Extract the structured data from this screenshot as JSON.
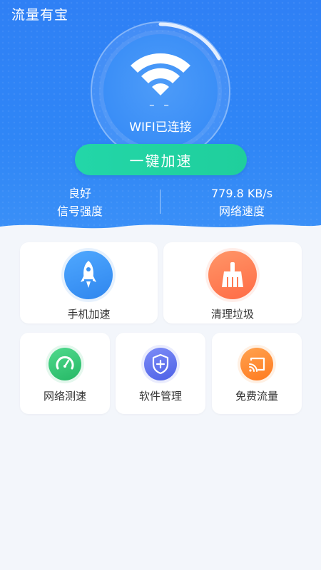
{
  "header": {
    "app_title": "流量有宝"
  },
  "status": {
    "speed_placeholder": "– –",
    "wifi_text": "WIFI已连接",
    "boost_label": "一键加速"
  },
  "stats": {
    "signal_value": "良好",
    "signal_label": "信号强度",
    "speed_value": "779.8 KB/s",
    "speed_label": "网络速度"
  },
  "tools": {
    "phone_boost": {
      "label": "手机加速",
      "icon": "rocket-icon",
      "color": "#2f8cf2"
    },
    "clean_junk": {
      "label": "清理垃圾",
      "icon": "broom-icon",
      "color": "#ff7a52"
    },
    "speed_test": {
      "label": "网络测速",
      "icon": "speedometer-icon",
      "color": "#2fc475"
    },
    "app_manage": {
      "label": "软件管理",
      "icon": "shield-plus-icon",
      "color": "#5a6ff0"
    },
    "free_data": {
      "label": "免费流量",
      "icon": "cast-icon",
      "color": "#ff8a2a"
    }
  },
  "theme": {
    "primary": "#2f80f5",
    "accent_green": "#1fcf9c",
    "background": "#f3f6fb"
  }
}
